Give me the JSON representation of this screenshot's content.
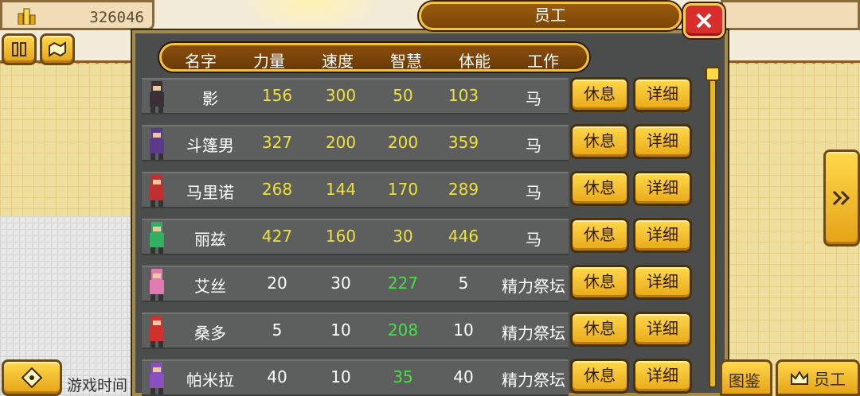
{
  "top": {
    "money": "326046"
  },
  "window": {
    "title": "员工"
  },
  "headers": {
    "name": "名字",
    "strength": "力量",
    "speed": "速度",
    "intellect": "智慧",
    "stamina": "体能",
    "job": "工作"
  },
  "buttons": {
    "rest": "休息",
    "detail": "详细"
  },
  "rows": [
    {
      "name": "影",
      "strength": "156",
      "speed": "300",
      "intellect": "50",
      "stamina": "103",
      "job": "马",
      "color": "#3a3038"
    },
    {
      "name": "斗篷男",
      "strength": "327",
      "speed": "200",
      "intellect": "200",
      "stamina": "359",
      "job": "马",
      "color": "#5a3a8a"
    },
    {
      "name": "马里诺",
      "strength": "268",
      "speed": "144",
      "intellect": "170",
      "stamina": "289",
      "job": "马",
      "color": "#c03030"
    },
    {
      "name": "丽兹",
      "strength": "427",
      "speed": "160",
      "intellect": "30",
      "stamina": "446",
      "job": "马",
      "color": "#30b060"
    },
    {
      "name": "艾丝",
      "strength": "20",
      "speed": "30",
      "intellect": "227",
      "stamina": "5",
      "job": "精力祭坛",
      "color": "#e07ab0"
    },
    {
      "name": "桑多",
      "strength": "5",
      "speed": "10",
      "intellect": "208",
      "stamina": "10",
      "job": "精力祭坛",
      "color": "#d03030"
    },
    {
      "name": "帕米拉",
      "strength": "40",
      "speed": "10",
      "intellect": "35",
      "stamina": "40",
      "job": "精力祭坛",
      "color": "#8a50c0"
    }
  ],
  "bottom": {
    "game_time": "游戏时间",
    "codex": "图鉴",
    "staff": "员工"
  }
}
